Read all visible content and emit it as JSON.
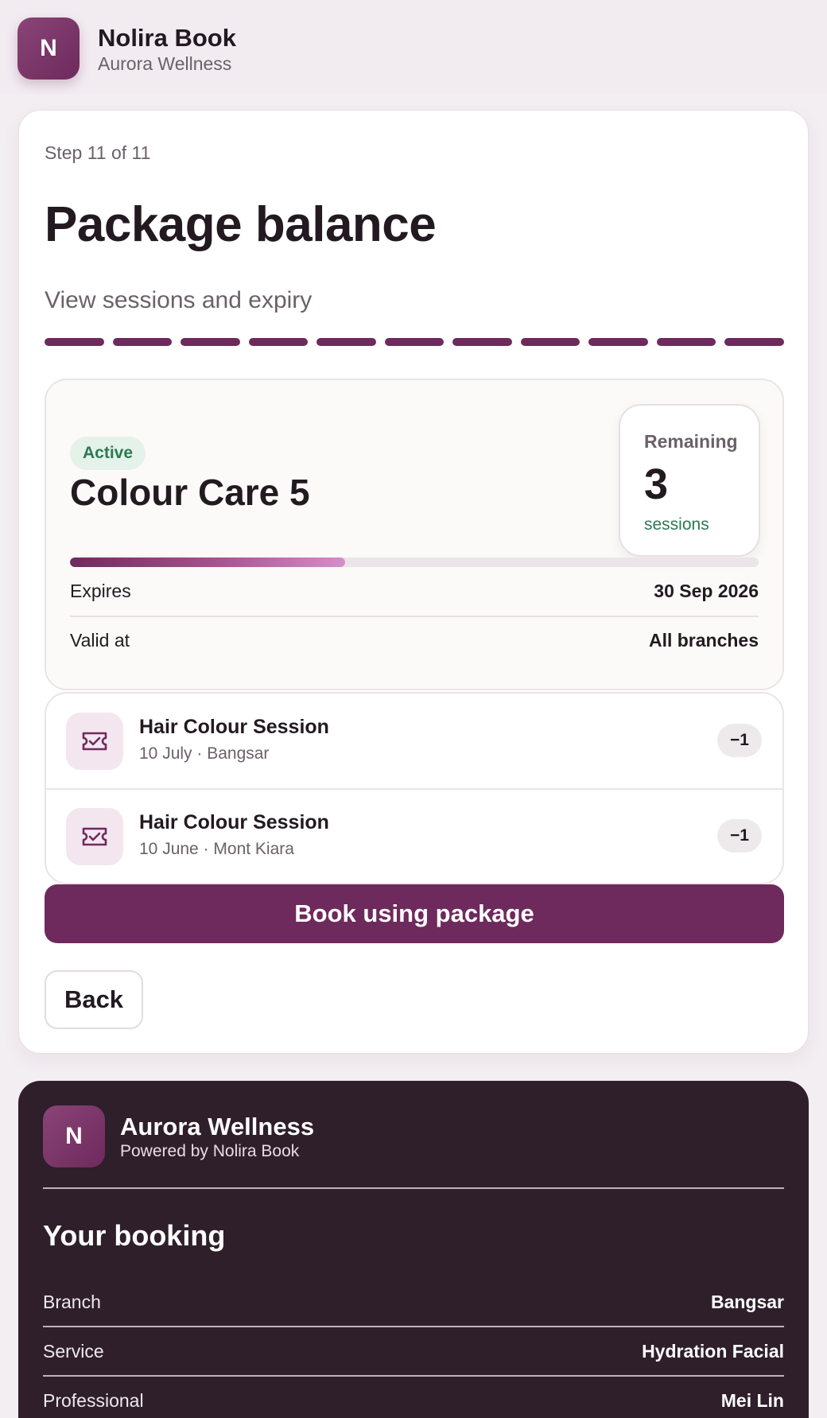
{
  "app": {
    "logo_letter": "N",
    "name": "Nolira Book",
    "business": "Aurora Wellness"
  },
  "step": {
    "label": "Step 11 of 11",
    "current": 11,
    "total": 11
  },
  "page": {
    "title": "Package balance",
    "subtitle": "View sessions and expiry"
  },
  "package": {
    "status": "Active",
    "name": "Colour Care 5",
    "remaining_label": "Remaining",
    "remaining_value": "3",
    "remaining_unit": "sessions",
    "usage_fraction": 0.4,
    "expires_label": "Expires",
    "expires_value": "30 Sep 2026",
    "valid_label": "Valid at",
    "valid_value": "All branches"
  },
  "history": [
    {
      "title": "Hair Colour Session",
      "detail": "10 July · Bangsar",
      "delta": "−1",
      "icon": "ticket-icon"
    },
    {
      "title": "Hair Colour Session",
      "detail": "10 June · Mont Kiara",
      "delta": "−1",
      "icon": "ticket-icon"
    }
  ],
  "actions": {
    "primary": "Book using package",
    "back": "Back"
  },
  "footer": {
    "logo_letter": "N",
    "business": "Aurora Wellness",
    "powered_by": "Powered by Nolira Book",
    "section_title": "Your booking",
    "rows": [
      {
        "label": "Branch",
        "value": "Bangsar"
      },
      {
        "label": "Service",
        "value": "Hydration Facial"
      },
      {
        "label": "Professional",
        "value": "Mei Lin"
      }
    ]
  },
  "colors": {
    "brand": "#6e2a5c",
    "active_green": "#2a7a52",
    "footer_bg": "#2e1f2b"
  }
}
